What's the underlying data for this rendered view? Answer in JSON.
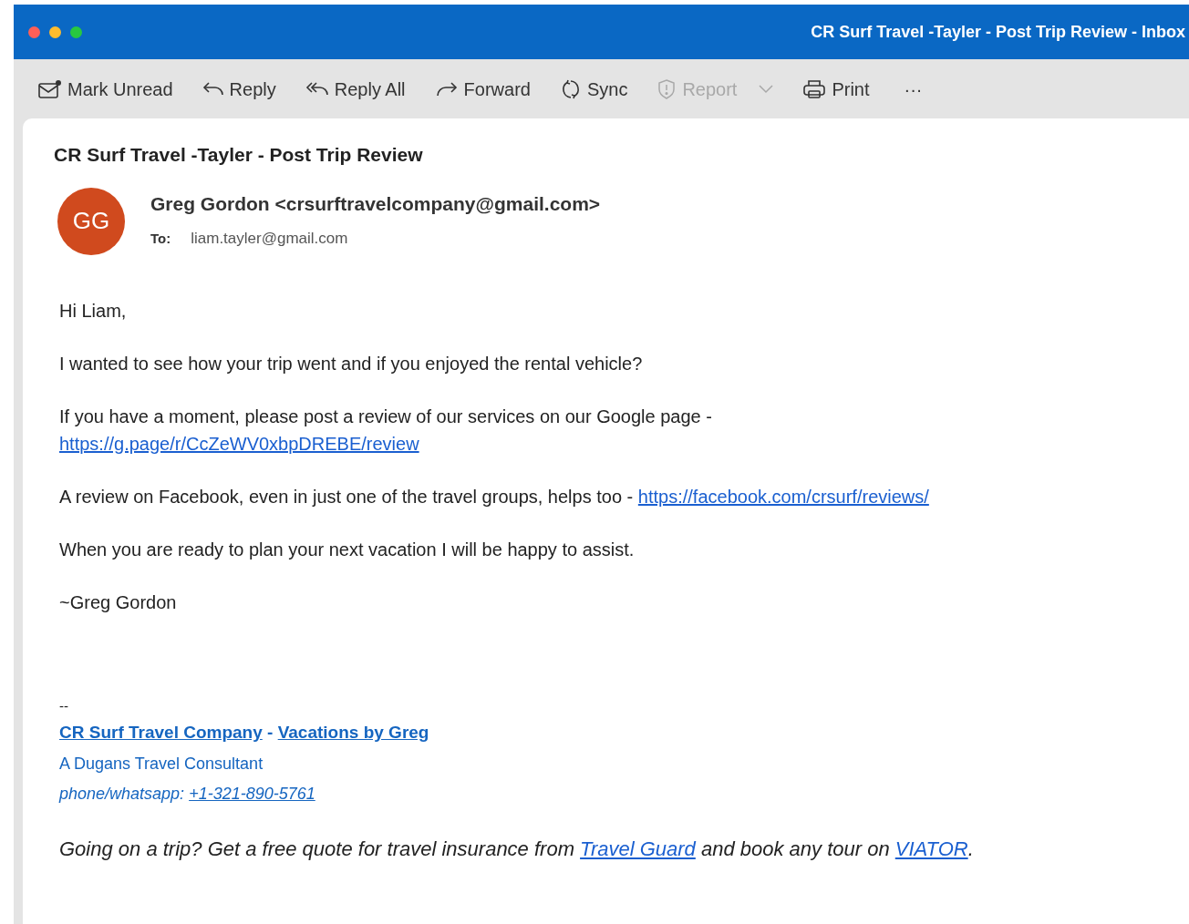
{
  "window": {
    "title": "CR Surf Travel -Tayler - Post Trip Review - Inbox"
  },
  "toolbar": [
    {
      "kind": "mark-unread",
      "label": "Mark Unread",
      "disabled": false
    },
    {
      "kind": "reply",
      "label": "Reply",
      "disabled": false
    },
    {
      "kind": "reply-all",
      "label": "Reply All",
      "disabled": false
    },
    {
      "kind": "forward",
      "label": "Forward",
      "disabled": false
    },
    {
      "kind": "sync",
      "label": "Sync",
      "disabled": false
    },
    {
      "kind": "report",
      "label": "Report",
      "disabled": true,
      "dropdown": true
    },
    {
      "kind": "print",
      "label": "Print",
      "disabled": false
    },
    {
      "kind": "more",
      "label": "···",
      "disabled": false
    }
  ],
  "message": {
    "subject": "CR Surf Travel -Tayler - Post Trip Review",
    "avatar": {
      "initials": "GG",
      "color": "#d04a1e"
    },
    "from": "Greg Gordon <crsurftravelcompany@gmail.com>",
    "to_label": "To:",
    "to": "liam.tayler@gmail.com",
    "body": [
      {
        "lines": [
          [
            {
              "kind": "text",
              "text": "Hi Liam,"
            }
          ]
        ]
      },
      {
        "lines": [
          [
            {
              "kind": "text",
              "text": "I wanted to see how your trip went and if you enjoyed the rental vehicle?"
            }
          ]
        ]
      },
      {
        "lines": [
          [
            {
              "kind": "text",
              "text": "If you have a moment, please post a review of our services on our Google page -"
            }
          ],
          [
            {
              "kind": "link",
              "text": "https://g.page/r/CcZeWV0xbpDREBE/review"
            }
          ]
        ]
      },
      {
        "lines": [
          [
            {
              "kind": "text",
              "text": "A review on Facebook, even in just one of the travel groups, helps too - "
            },
            {
              "kind": "link",
              "text": "https://facebook.com/crsurf/reviews/"
            }
          ]
        ]
      },
      {
        "lines": [
          [
            {
              "kind": "text",
              "text": "When you are ready to plan your next vacation I will be happy to assist."
            }
          ]
        ]
      },
      {
        "lines": [
          [
            {
              "kind": "text",
              "text": "~Greg Gordon"
            }
          ]
        ]
      }
    ],
    "signature": {
      "separator": "--",
      "company_link": "CR Surf Travel Company",
      "dash": " - ",
      "vacations_link": "Vacations by Greg",
      "role": "A Dugans Travel Consultant",
      "phone_label": "phone/whatsapp: ",
      "phone_link": "+1-321-890-5761"
    },
    "footer": [
      {
        "kind": "text",
        "text": "Going on a trip? Get a free quote for travel insurance from "
      },
      {
        "kind": "link",
        "text": "Travel Guard"
      },
      {
        "kind": "text",
        "text": " and book any tour on "
      },
      {
        "kind": "link",
        "text": "VIATOR"
      },
      {
        "kind": "text",
        "text": "."
      }
    ]
  }
}
